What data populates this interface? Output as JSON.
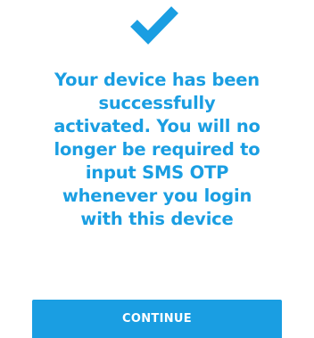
{
  "success": {
    "icon": "checkmark-icon",
    "message_lines": [
      "Your device has been",
      "successfully",
      "activated. You will no",
      "longer be required to",
      "input SMS OTP",
      "whenever you login",
      "with this device"
    ]
  },
  "actions": {
    "continue_label": "CONTINUE"
  },
  "colors": {
    "accent": "#1a9ee2",
    "background": "#ffffff",
    "button_text": "#ffffff"
  }
}
